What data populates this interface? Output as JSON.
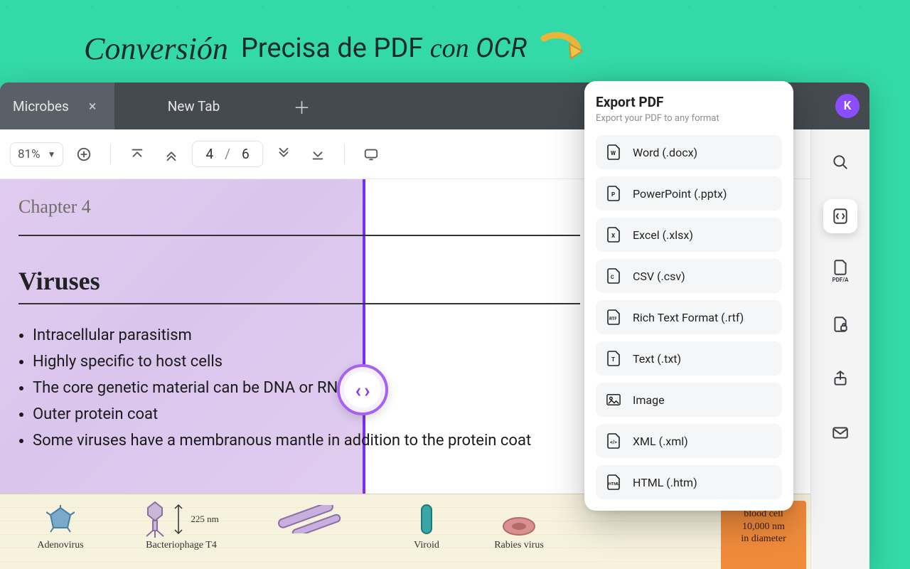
{
  "marketing": {
    "word1": "Conversión",
    "word2": "Precisa de PDF",
    "word3": "con",
    "word4": "OCR"
  },
  "tabs": [
    {
      "label": "Microbes",
      "active": true
    },
    {
      "label": "New Tab",
      "active": false
    }
  ],
  "avatar_letter": "K",
  "toolbar": {
    "zoom": "81%",
    "page_current": "4",
    "page_total": "6"
  },
  "document": {
    "chapter": "Chapter 4",
    "heading": "Viruses",
    "bullets": [
      "Intracellular parasitism",
      "Highly specific to host cells",
      "The core genetic material can be DNA or RNA",
      "Outer protein coat",
      "Some viruses have a membranous mantle in addition to the protein coat"
    ],
    "virus_labels": {
      "adeno": "Adenovirus",
      "bacteriophage": "Bacteriophage T4",
      "bacteriophage_size": "225 nm",
      "viroid": "Viroid",
      "rabies": "Rabies virus"
    },
    "blood_note": {
      "l1": "blood cell",
      "l2": "10,000 nm",
      "l3": "in diameter"
    }
  },
  "export": {
    "title": "Export PDF",
    "subtitle": "Export your PDF to any format",
    "options": [
      "Word (.docx)",
      "PowerPoint (.pptx)",
      "Excel (.xlsx)",
      "CSV (.csv)",
      "Rich Text Format (.rtf)",
      "Text (.txt)",
      "Image",
      "XML (.xml)",
      "HTML (.htm)"
    ]
  }
}
